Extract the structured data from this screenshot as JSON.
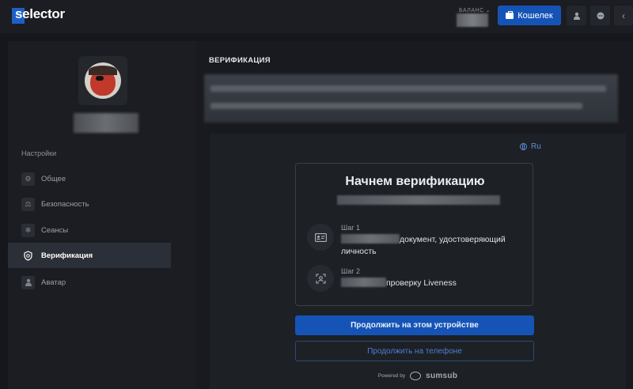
{
  "app": {
    "logo_text": "selector"
  },
  "header": {
    "balance_label": "БАЛАНС",
    "wallet_button": "Кошелек"
  },
  "sidebar": {
    "settings_heading": "Настройки",
    "items": [
      {
        "label": "Общее",
        "icon": "gear-icon",
        "active": false
      },
      {
        "label": "Безопасность",
        "icon": "scales-icon",
        "active": false
      },
      {
        "label": "Сеансы",
        "icon": "sessions-icon",
        "active": false
      },
      {
        "label": "Верификация",
        "icon": "shield-icon",
        "active": true
      },
      {
        "label": "Аватар",
        "icon": "user-icon",
        "active": false
      }
    ]
  },
  "main": {
    "title": "ВЕРИФИКАЦИЯ",
    "language": "Ru",
    "card": {
      "title": "Начнем верификацию",
      "steps": [
        {
          "label": "Шаг 1",
          "text": "документ, удостоверяющий личность",
          "icon": "id-card-icon"
        },
        {
          "label": "Шаг 2",
          "text": "проверку Liveness",
          "icon": "face-scan-icon"
        }
      ]
    },
    "continue_device": "Продолжить на этом устройстве",
    "continue_phone": "Продолжить на телефоне",
    "powered_by": "Powered by",
    "provider": "sumsub"
  },
  "colors": {
    "accent": "#1554b6",
    "link": "#4d7fd4",
    "background": "#15171c",
    "panel": "#1b1d22"
  }
}
